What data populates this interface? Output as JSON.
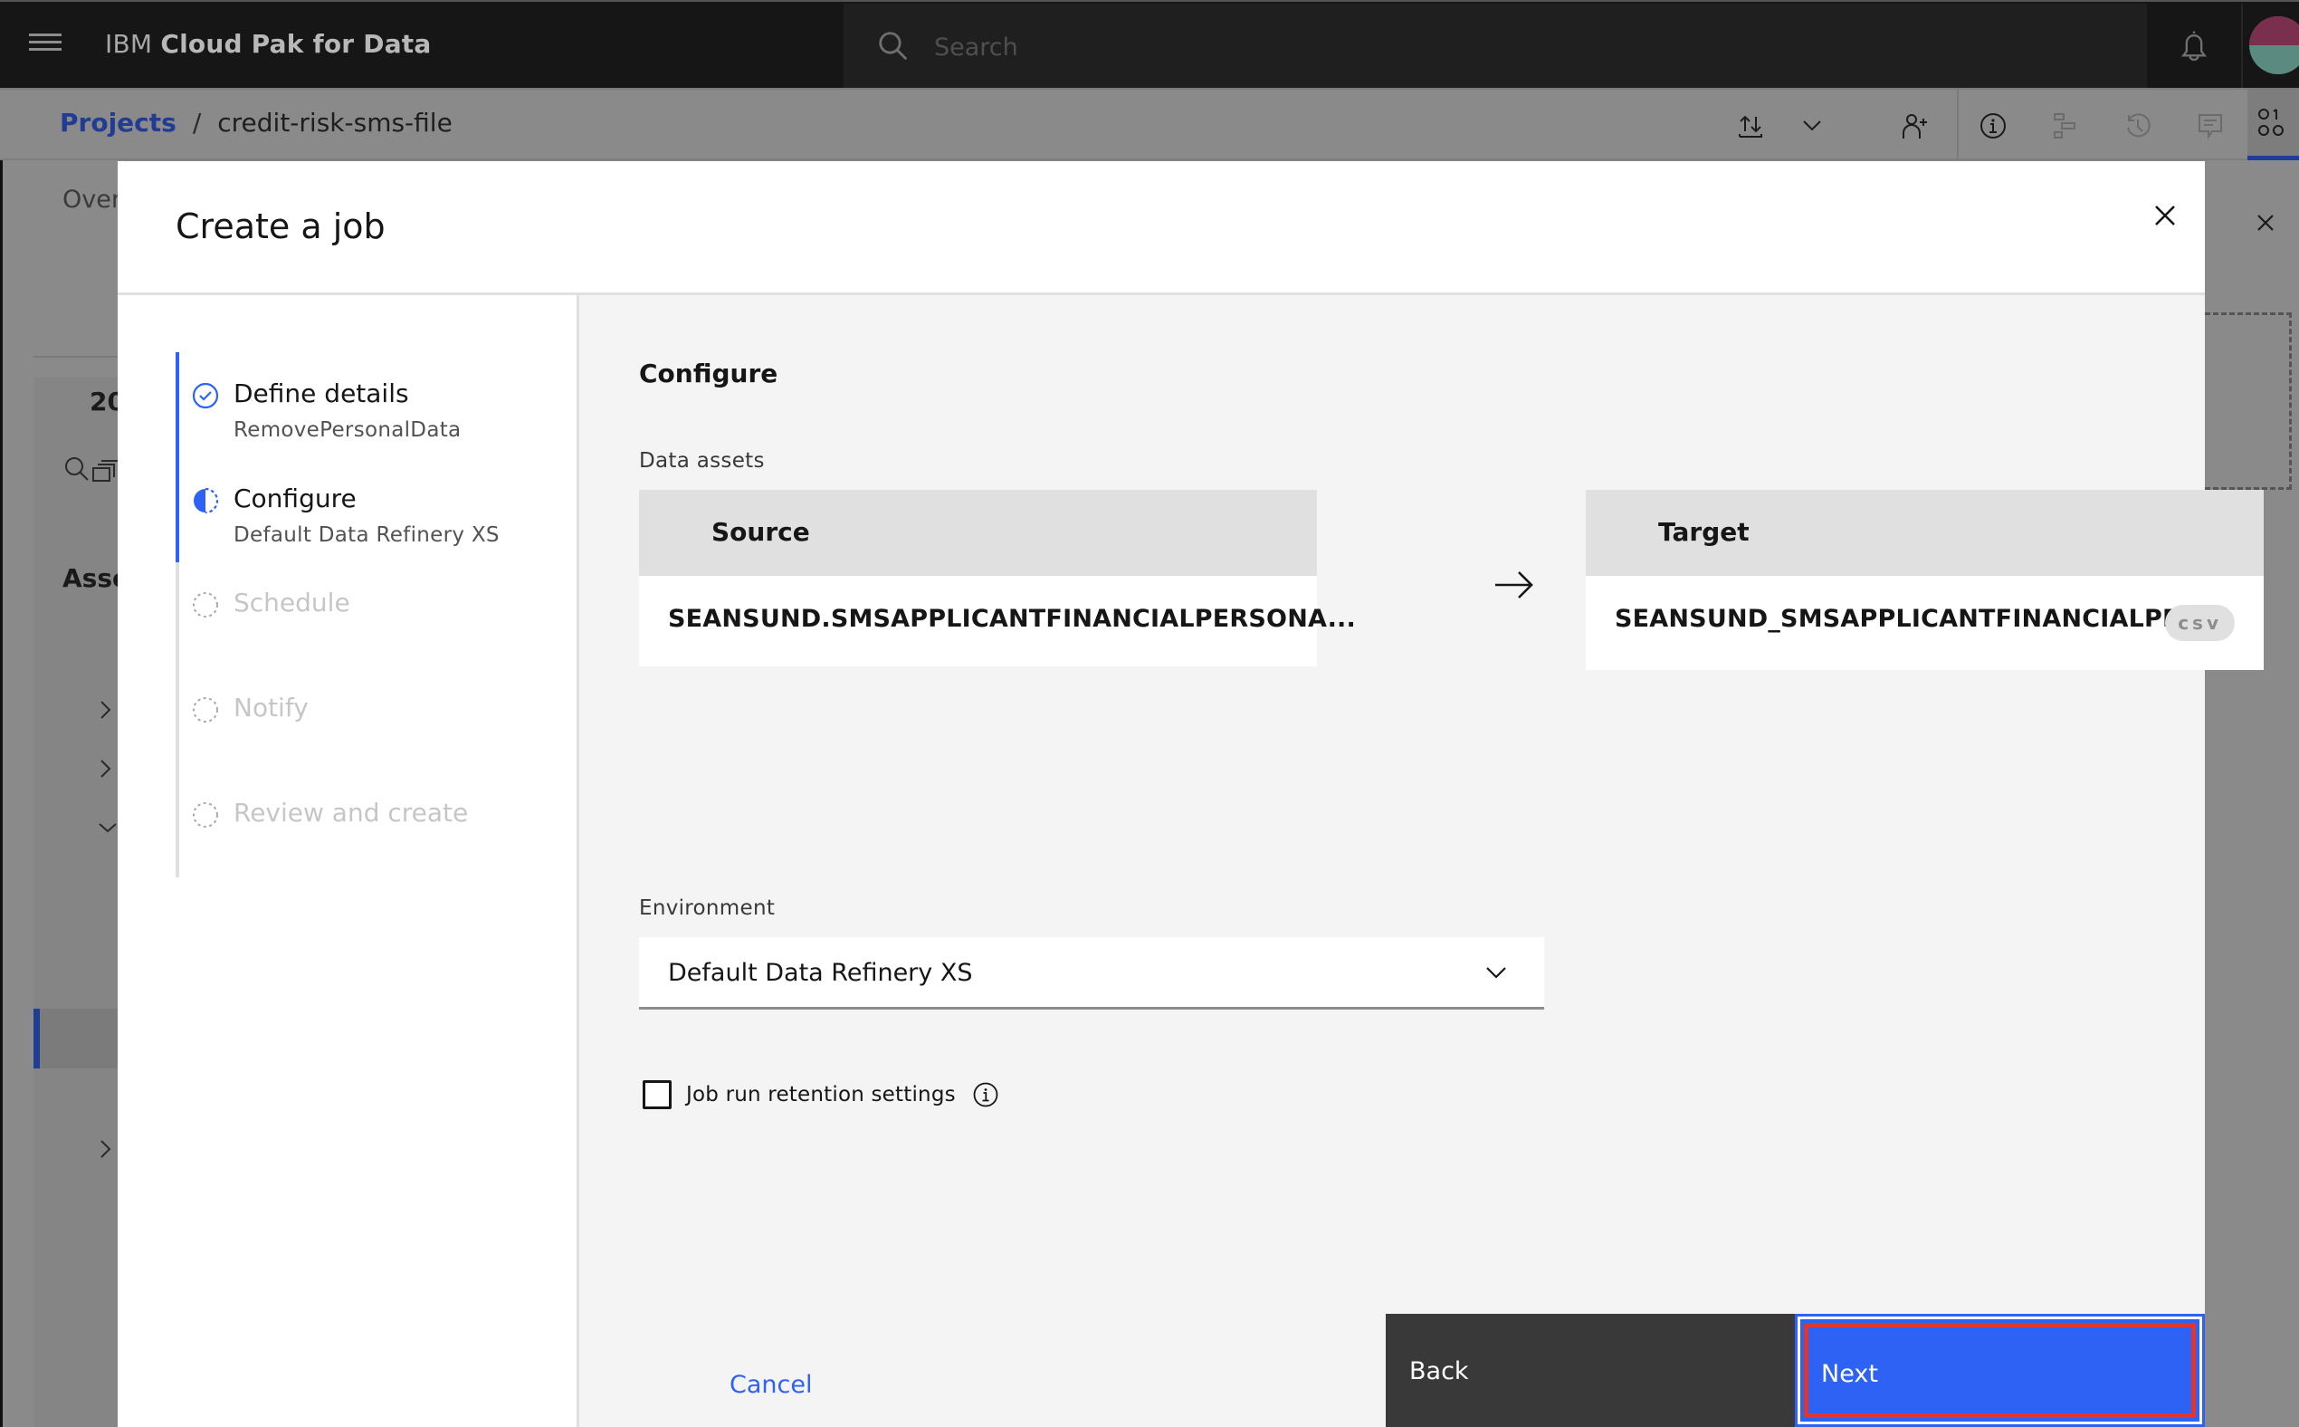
{
  "app": {
    "brand_prefix": "IBM",
    "brand_name": "Cloud Pak for Data",
    "search_placeholder": "Search"
  },
  "breadcrumb": {
    "items": [
      {
        "label": "Projects",
        "link": true
      },
      {
        "label": "credit-risk-sms-file",
        "link": false
      }
    ],
    "separator": "/"
  },
  "toolbar": {
    "icons": [
      "upload-download-icon",
      "chevron-down-icon",
      "add-collaborator-icon",
      "information-icon",
      "lineage-icon",
      "history-icon",
      "comments-icon",
      "code-snippets-icon"
    ]
  },
  "background": {
    "tab_partial": "Overv",
    "count_partial": "20",
    "assets_partial": "Asse"
  },
  "modal": {
    "title": "Create a job",
    "steps": [
      {
        "label": "Define details",
        "sub": "RemovePersonalData",
        "state": "complete"
      },
      {
        "label": "Configure",
        "sub": "Default Data Refinery XS",
        "state": "current"
      },
      {
        "label": "Schedule",
        "sub": "",
        "state": "incomplete"
      },
      {
        "label": "Notify",
        "sub": "",
        "state": "incomplete"
      },
      {
        "label": "Review and create",
        "sub": "",
        "state": "incomplete"
      }
    ],
    "progress": {
      "current_step": 2,
      "total_steps": 5
    },
    "content": {
      "heading": "Configure",
      "data_assets_label": "Data assets",
      "source": {
        "header": "Source",
        "name": "SEANSUND.SMSAPPLICANTFINANCIALPERSONA..."
      },
      "target": {
        "header": "Target",
        "name": "SEANSUND_SMSAPPLICANTFINANCIALPER...",
        "tag": "csv"
      },
      "environment_label": "Environment",
      "environment_value": "Default Data Refinery XS",
      "retention_checkbox_label": "Job run retention settings",
      "retention_checked": false
    },
    "footer": {
      "cancel": "Cancel",
      "back": "Back",
      "next": "Next"
    }
  },
  "colors": {
    "primary": "#2d62f5",
    "secondary_button": "#393939",
    "highlight_outline": "#e0362c",
    "panel_bg": "#f4f4f4"
  }
}
